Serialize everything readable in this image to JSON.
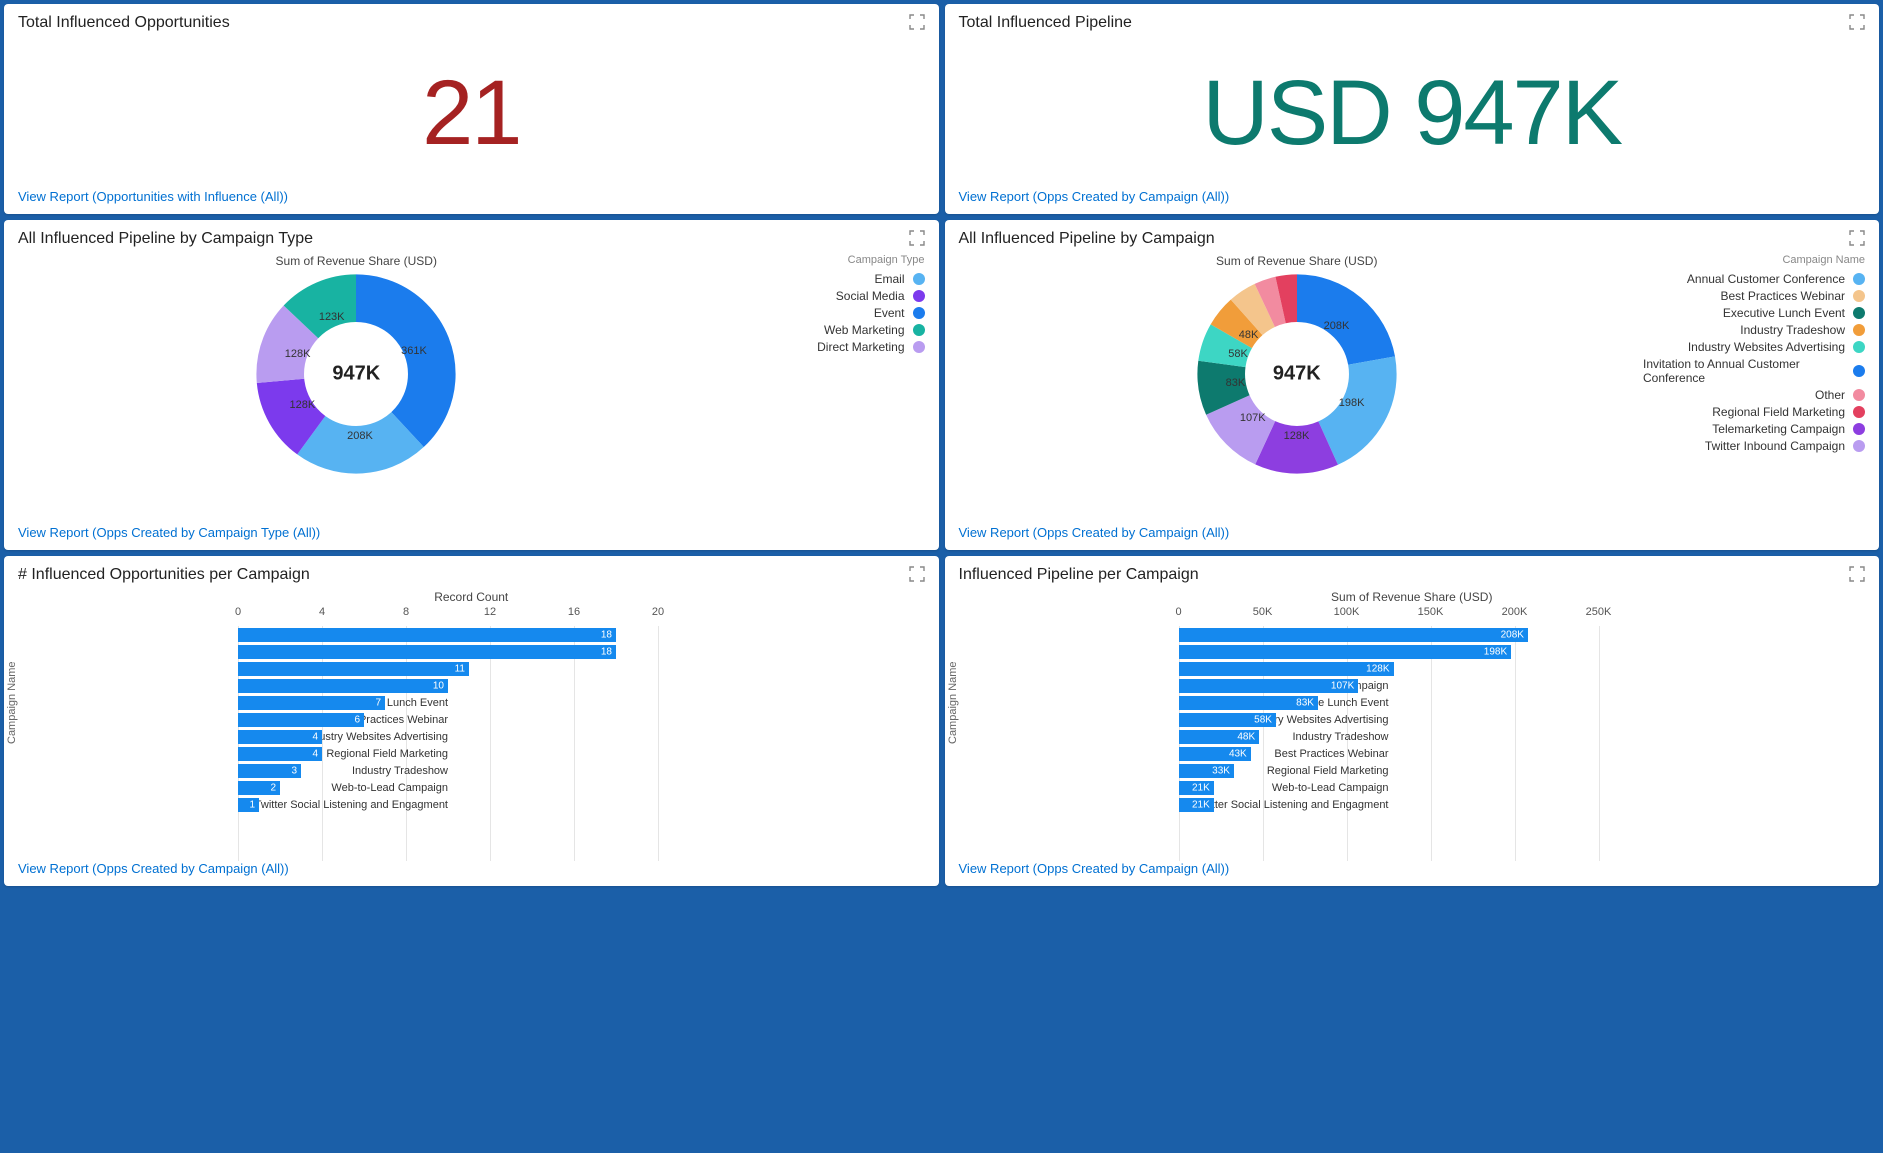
{
  "cards": {
    "opps": {
      "title": "Total Influenced Opportunities",
      "value": "21",
      "link": "View Report (Opportunities with Influence (All))"
    },
    "pipeline": {
      "title": "Total Influenced Pipeline",
      "value": "USD 947K",
      "link": "View Report (Opps Created by Campaign (All))"
    },
    "donut_type": {
      "title": "All Influenced Pipeline by Campaign Type",
      "subtitle": "Sum of Revenue Share (USD)",
      "center": "947K",
      "legend_title": "Campaign Type",
      "link": "View Report (Opps Created by Campaign Type (All))"
    },
    "donut_campaign": {
      "title": "All Influenced Pipeline by Campaign",
      "subtitle": "Sum of Revenue Share (USD)",
      "center": "947K",
      "legend_title": "Campaign Name",
      "link": "View Report (Opps Created by Campaign (All))"
    },
    "bar_opps": {
      "title": "# Influenced Opportunities per Campaign",
      "subtitle": "Record Count",
      "yaxis": "Campaign Name",
      "link": "View Report (Opps Created by Campaign (All))"
    },
    "bar_pipeline": {
      "title": "Influenced Pipeline per Campaign",
      "subtitle": "Sum of Revenue Share (USD)",
      "yaxis": "Campaign Name",
      "link": "View Report (Opps Created by Campaign (All))"
    }
  },
  "chart_data": [
    {
      "id": "donut_type",
      "type": "donut",
      "title": "All Influenced Pipeline by Campaign Type",
      "subtitle": "Sum of Revenue Share (USD)",
      "total_label": "947K",
      "series": [
        {
          "name": "Email",
          "value": 208,
          "label": "208K",
          "color": "#57b3f2"
        },
        {
          "name": "Social Media",
          "value": 128,
          "label": "128K",
          "color": "#7c3aed"
        },
        {
          "name": "Event",
          "value": 361,
          "label": "361K",
          "color": "#1b7ced"
        },
        {
          "name": "Web Marketing",
          "value": 123,
          "label": "123K",
          "color": "#18b3a2"
        },
        {
          "name": "Direct Marketing",
          "value": 128,
          "label": "128K",
          "color": "#b99cf0"
        }
      ]
    },
    {
      "id": "donut_campaign",
      "type": "donut",
      "title": "All Influenced Pipeline by Campaign",
      "subtitle": "Sum of Revenue Share (USD)",
      "total_label": "947K",
      "series": [
        {
          "name": "Annual Customer Conference",
          "value": 198,
          "label": "198K",
          "color": "#57b3f2"
        },
        {
          "name": "Best Practices Webinar",
          "value": 43,
          "label": "",
          "color": "#f4c58c"
        },
        {
          "name": "Executive Lunch Event",
          "value": 83,
          "label": "83K",
          "color": "#0d7a6e"
        },
        {
          "name": "Industry Tradeshow",
          "value": 48,
          "label": "48K",
          "color": "#f19d3a"
        },
        {
          "name": "Industry Websites Advertising",
          "value": 58,
          "label": "58K",
          "color": "#3dd6c4"
        },
        {
          "name": "Invitation to Annual Customer Conference",
          "value": 208,
          "label": "208K",
          "color": "#1b7ced"
        },
        {
          "name": "Other",
          "value": 33,
          "label": "",
          "color": "#f28ba0"
        },
        {
          "name": "Regional Field Marketing",
          "value": 33,
          "label": "",
          "color": "#e3405f"
        },
        {
          "name": "Telemarketing Campaign",
          "value": 128,
          "label": "128K",
          "color": "#8d3ee0"
        },
        {
          "name": "Twitter Inbound Campaign",
          "value": 107,
          "label": "107K",
          "color": "#b99cf0"
        }
      ],
      "render_order": [
        "Invitation to Annual Customer Conference",
        "Annual Customer Conference",
        "Telemarketing Campaign",
        "Twitter Inbound Campaign",
        "Executive Lunch Event",
        "Industry Websites Advertising",
        "Industry Tradeshow",
        "Best Practices Webinar",
        "Other",
        "Regional Field Marketing"
      ]
    },
    {
      "id": "bar_opps",
      "type": "bar",
      "title": "# Influenced Opportunities per Campaign",
      "xlabel": "Record Count",
      "ylabel": "Campaign Name",
      "xmax": 20,
      "ticks": [
        0,
        4,
        8,
        12,
        16,
        20
      ],
      "categories": [
        "Annual Customer Conference",
        "Invitation to Annual Customer Conference",
        "Twitter Inbound Campaign",
        "Telemarketing Campaign",
        "Executive Lunch Event",
        "Best Practices Webinar",
        "Industry Websites Advertising",
        "Regional Field Marketing",
        "Industry Tradeshow",
        "Web-to-Lead Campaign",
        "Twitter Social Listening and Engagment"
      ],
      "values": [
        18,
        18,
        11,
        10,
        7,
        6,
        4,
        4,
        3,
        2,
        1
      ],
      "value_labels": [
        "18",
        "18",
        "11",
        "10",
        "7",
        "6",
        "4",
        "4",
        "3",
        "2",
        "1"
      ]
    },
    {
      "id": "bar_pipeline",
      "type": "bar",
      "title": "Influenced Pipeline per Campaign",
      "xlabel": "Sum of Revenue Share (USD)",
      "ylabel": "Campaign Name",
      "xmax": 250,
      "ticks": [
        0,
        50,
        100,
        150,
        200,
        250
      ],
      "tick_labels": [
        "0",
        "50K",
        "100K",
        "150K",
        "200K",
        "250K"
      ],
      "categories": [
        "Invitation to Annual Customer Conference",
        "Annual Customer Conference",
        "Telemarketing Campaign",
        "Twitter Inbound Campaign",
        "Executive Lunch Event",
        "Industry Websites Advertising",
        "Industry Tradeshow",
        "Best Practices Webinar",
        "Regional Field Marketing",
        "Web-to-Lead Campaign",
        "Twitter Social Listening and Engagment"
      ],
      "values": [
        208,
        198,
        128,
        107,
        83,
        58,
        48,
        43,
        33,
        21,
        21
      ],
      "value_labels": [
        "208K",
        "198K",
        "128K",
        "107K",
        "83K",
        "58K",
        "48K",
        "43K",
        "33K",
        "21K",
        "21K"
      ]
    }
  ]
}
